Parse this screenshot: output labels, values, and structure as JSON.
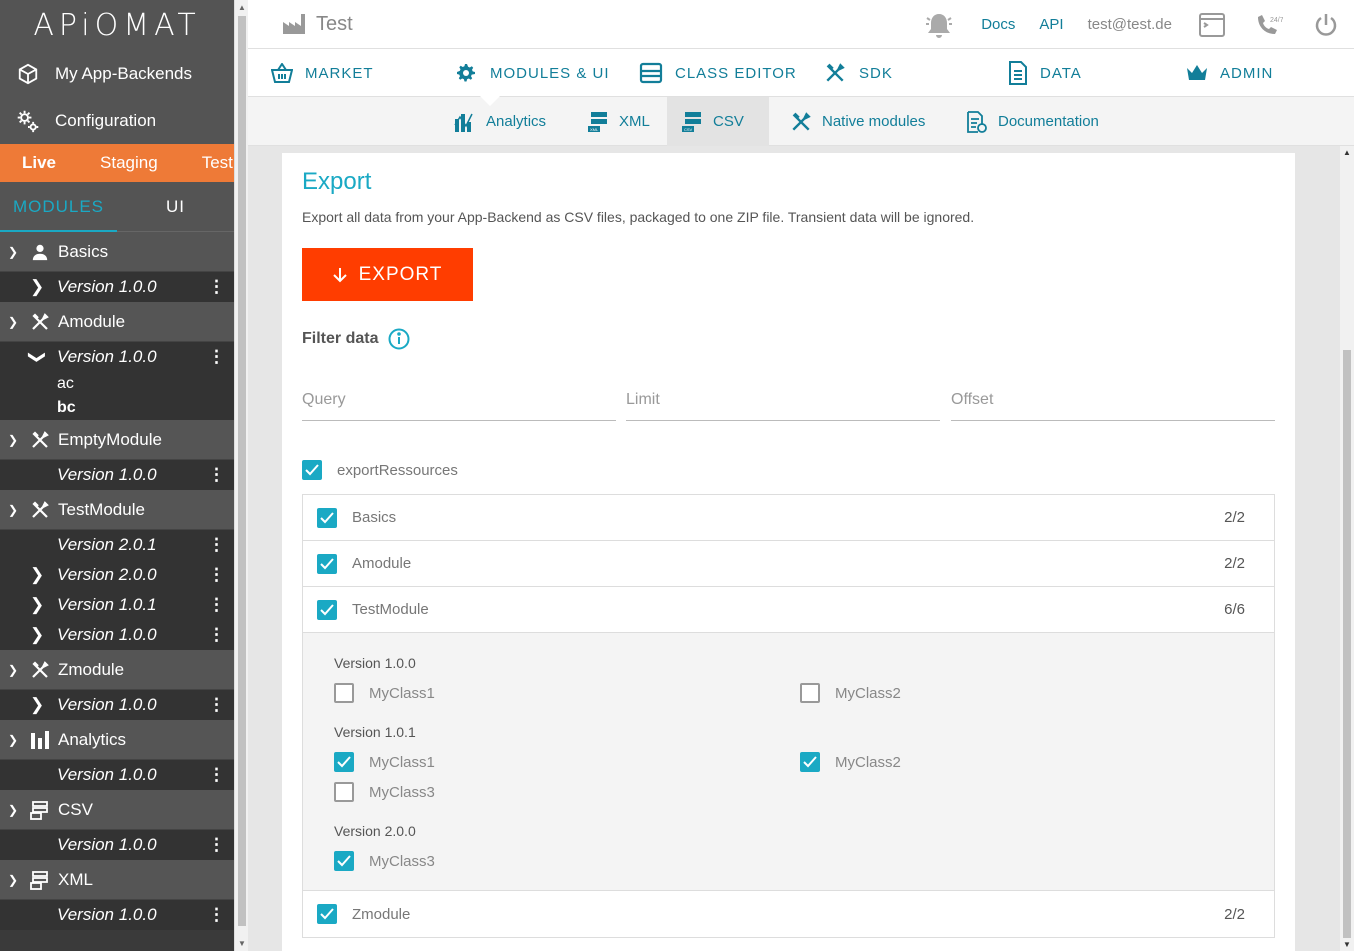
{
  "app": {
    "logo": "APiOMAT"
  },
  "sidebar": {
    "nav": [
      {
        "label": "My App-Backends",
        "icon": "cube-icon"
      },
      {
        "label": "Configuration",
        "icon": "gears-icon"
      }
    ],
    "envs": [
      "Live",
      "Staging",
      "Test"
    ],
    "active_env": "Live",
    "tabs": [
      "MODULES",
      "UI"
    ],
    "modules": [
      {
        "name": "Basics",
        "icon": "person-icon",
        "versions": [
          {
            "label": "Version 1.0.0",
            "chevron": "right"
          }
        ]
      },
      {
        "name": "Amodule",
        "icon": "tools-icon",
        "versions": [
          {
            "label": "Version 1.0.0",
            "chevron": "down",
            "classes": [
              "ac",
              "bc"
            ]
          }
        ]
      },
      {
        "name": "EmptyModule",
        "icon": "tools-icon",
        "versions": [
          {
            "label": "Version 1.0.0",
            "chevron": ""
          }
        ]
      },
      {
        "name": "TestModule",
        "icon": "tools-icon",
        "versions": [
          {
            "label": "Version 2.0.1",
            "chevron": ""
          },
          {
            "label": "Version 2.0.0",
            "chevron": "right"
          },
          {
            "label": "Version 1.0.1",
            "chevron": "right"
          },
          {
            "label": "Version 1.0.0",
            "chevron": "right"
          }
        ]
      },
      {
        "name": "Zmodule",
        "icon": "tools-icon",
        "versions": [
          {
            "label": "Version 1.0.0",
            "chevron": "right"
          }
        ]
      },
      {
        "name": "Analytics",
        "icon": "analytics-icon",
        "versions": [
          {
            "label": "Version 1.0.0",
            "chevron": ""
          }
        ]
      },
      {
        "name": "CSV",
        "icon": "csv-icon",
        "versions": [
          {
            "label": "Version 1.0.0",
            "chevron": ""
          }
        ]
      },
      {
        "name": "XML",
        "icon": "xml-icon",
        "versions": [
          {
            "label": "Version 1.0.0",
            "chevron": ""
          }
        ]
      }
    ]
  },
  "topbar": {
    "title": "Test",
    "docs": "Docs",
    "api": "API",
    "user": "test@test.de"
  },
  "mainnav": [
    {
      "label": "MARKET",
      "icon": "basket-icon"
    },
    {
      "label": "MODULES & UI",
      "icon": "gear-icon"
    },
    {
      "label": "CLASS EDITOR",
      "icon": "class-editor-icon"
    },
    {
      "label": "SDK",
      "icon": "tools-icon"
    },
    {
      "label": "DATA",
      "icon": "data-icon"
    },
    {
      "label": "ADMIN",
      "icon": "crown-icon"
    }
  ],
  "subnav": [
    {
      "label": "Analytics",
      "icon": "analytics-icon"
    },
    {
      "label": "XML",
      "icon": "xml-icon"
    },
    {
      "label": "CSV",
      "icon": "csv-icon",
      "active": true
    },
    {
      "label": "Native modules",
      "icon": "tools-icon"
    },
    {
      "label": "Documentation",
      "icon": "documentation-icon"
    }
  ],
  "export": {
    "title": "Export",
    "description": "Export all data from your App-Backend as CSV files, packaged to one ZIP file. Transient data will be ignored.",
    "button": "EXPORT",
    "filter_label": "Filter data",
    "fields": {
      "query": "Query",
      "limit": "Limit",
      "offset": "Offset"
    },
    "export_resources": {
      "label": "exportRessources",
      "checked": true
    },
    "modules": [
      {
        "name": "Basics",
        "checked": true,
        "count": "2/2"
      },
      {
        "name": "Amodule",
        "checked": true,
        "count": "2/2"
      },
      {
        "name": "TestModule",
        "checked": true,
        "count": "6/6"
      },
      {
        "name": "Zmodule",
        "checked": true,
        "count": "2/2"
      }
    ],
    "testmodule_versions": [
      {
        "label": "Version 1.0.0",
        "classes": [
          {
            "name": "MyClass1",
            "checked": false
          },
          {
            "name": "MyClass2",
            "checked": false
          }
        ]
      },
      {
        "label": "Version 1.0.1",
        "classes": [
          {
            "name": "MyClass1",
            "checked": true
          },
          {
            "name": "MyClass2",
            "checked": true
          },
          {
            "name": "MyClass3",
            "checked": false
          }
        ]
      },
      {
        "label": "Version 2.0.0",
        "classes": [
          {
            "name": "MyClass3",
            "checked": true
          }
        ]
      }
    ]
  }
}
